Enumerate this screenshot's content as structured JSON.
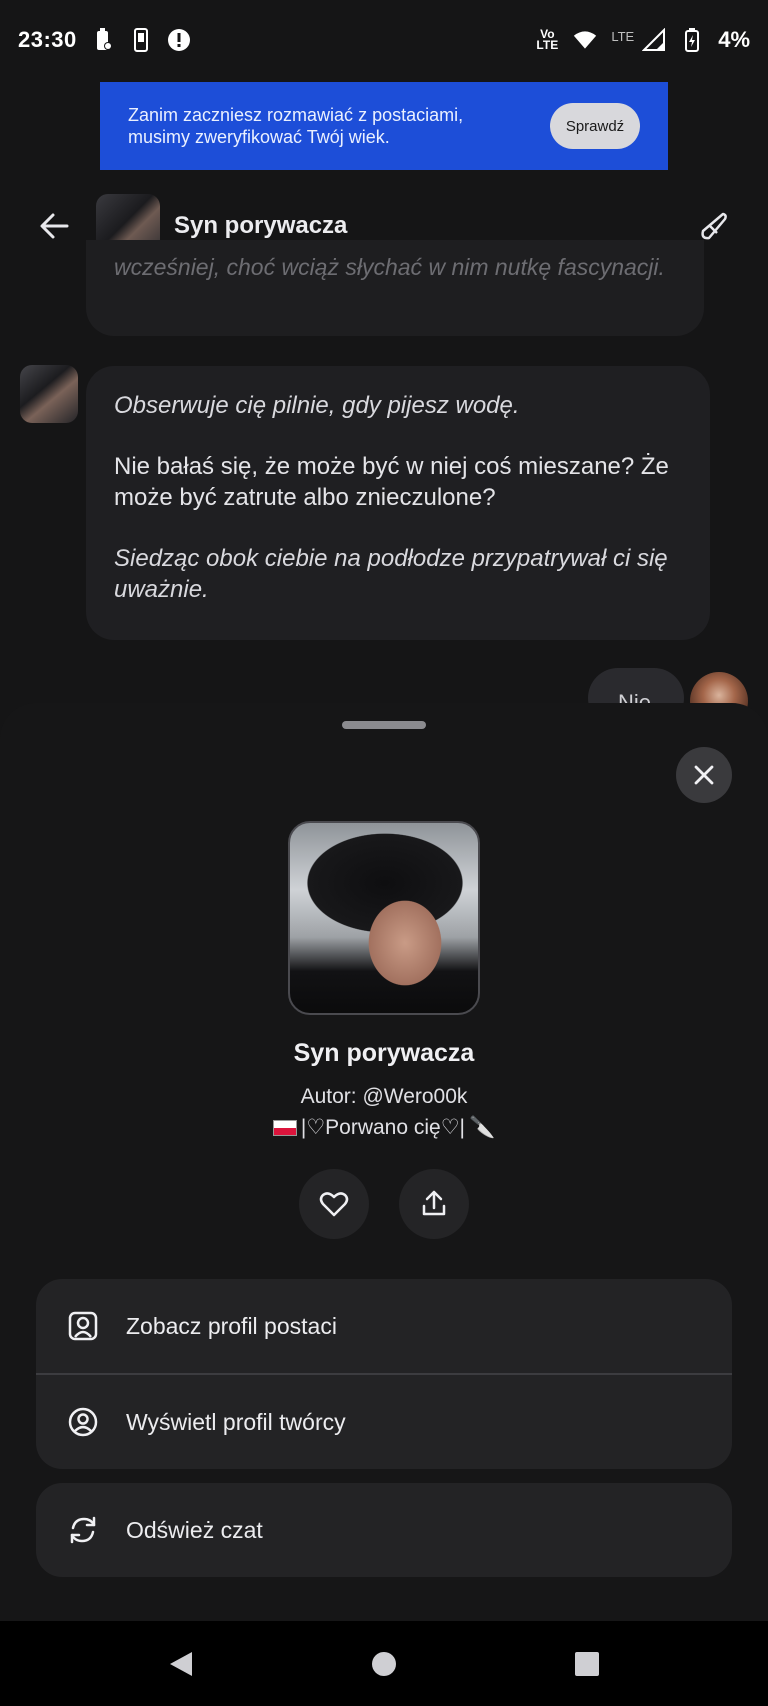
{
  "status_bar": {
    "time": "23:30",
    "battery": "4%",
    "network": "LTE",
    "volte": "Vo LTE"
  },
  "banner": {
    "text": "Zanim zaczniesz rozmawiać z postaciami, musimy zweryfikować Twój wiek.",
    "button": "Sprawdź",
    "color": "#1d4ed8"
  },
  "header": {
    "title": "Syn porywacza"
  },
  "messages": {
    "partial_text": "wcześniej, choć wciąż słychać w nim nutkę fascynacji.",
    "bot_message": {
      "line1": "Obserwuje cię pilnie, gdy pijesz wodę.",
      "line2": "Nie bałaś się, że może być w niej coś mieszane? Że może być zatrute albo znieczulone?",
      "line3": "Siedząc obok ciebie na podłodze przypatrywał ci się uważnie."
    },
    "user_message": "Nie"
  },
  "sheet": {
    "name": "Syn porywacza",
    "author": "Autor: @Wero00k",
    "tagline": "|♡Porwano cię♡|",
    "tagline_emoji_end": "🔪",
    "menu": {
      "view_character_profile": "Zobacz profil postaci",
      "view_creator_profile": "Wyświetl profil twórcy",
      "refresh_chat": "Odśwież czat"
    }
  },
  "icons": {
    "back": "arrow-left-icon",
    "edit": "edit-brush-icon",
    "close": "close-icon",
    "like": "heart-icon",
    "share": "share-icon",
    "profile": "user-square-icon",
    "creator": "user-circle-icon",
    "refresh": "refresh-icon"
  }
}
